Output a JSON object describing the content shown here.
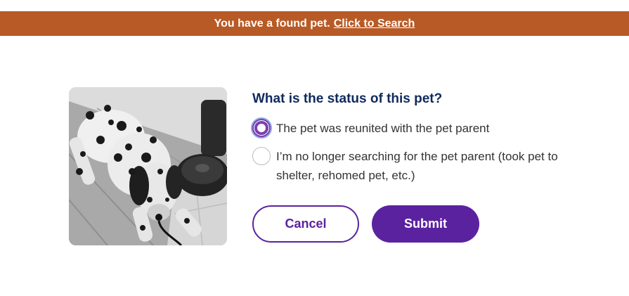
{
  "banner": {
    "message": "You have a found pet.",
    "link_text": "Click to Search",
    "background_color": "#b85a25"
  },
  "photo": {
    "alt": "Black and white photo of a spotted dog lying on the floor"
  },
  "form": {
    "question": "What is the status of this pet?",
    "options": [
      {
        "label": "The pet was reunited with the pet parent",
        "selected": true
      },
      {
        "label": "I’m no longer searching for the pet parent (took pet to shelter, rehomed pet, etc.)",
        "selected": false
      }
    ],
    "cancel_label": "Cancel",
    "submit_label": "Submit",
    "accent_color": "#5b22a0",
    "heading_color": "#0f2a5c"
  }
}
